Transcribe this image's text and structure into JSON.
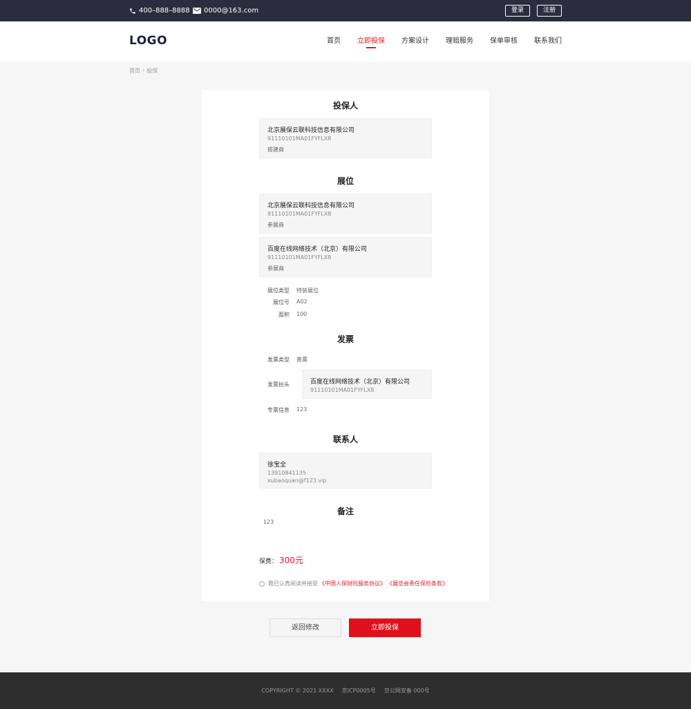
{
  "topbar": {
    "phone": "400–888–8888",
    "email": "0000@163.com",
    "login": "登录",
    "register": "注册"
  },
  "header": {
    "logo": "LOGO",
    "nav": [
      "首页",
      "立即投保",
      "方案设计",
      "理赔服务",
      "保单审核",
      "联系我们"
    ],
    "active": "立即投保"
  },
  "breadcrumb": {
    "home": "首页",
    "sep": "›",
    "current": "投保"
  },
  "policyholder": {
    "title": "投保人",
    "name": "北京展保云联科技信息有限公司",
    "code": "91110101MA01FYFLX8",
    "role": "搭建商"
  },
  "booth": {
    "title": "展位",
    "items": [
      {
        "name": "北京展保云联科技信息有限公司",
        "code": "91110101MA01FYFLX8",
        "role": "参展商"
      },
      {
        "name": "百度在线网络技术（北京）有限公司",
        "code": "91110101MA01FYFLX8",
        "role": "参展商"
      }
    ],
    "type_label": "展位类型",
    "type_value": "特装展位",
    "no_label": "展位号",
    "no_value": "A02",
    "area_label": "面积",
    "area_value": "100"
  },
  "invoice": {
    "title": "发票",
    "type_label": "发票类型",
    "type_value": "普票",
    "header_label": "发票抬头",
    "header_name": "百度在线网络技术（北京）有限公司",
    "header_code": "91110101MA01FYFLX8",
    "special_label": "专票信息",
    "special_value": "123"
  },
  "contact": {
    "title": "联系人",
    "name": "徐宝全",
    "phone": "13910841135",
    "email": "xubaoquan@f123.vip"
  },
  "remark": {
    "title": "备注",
    "value": "123"
  },
  "fee": {
    "label": "保费：",
    "amount": "300元"
  },
  "agreement": {
    "text": "我已认真阅读并接受",
    "link1": "《中国人保财险服务协议》",
    "link2": "《展览会责任保险条款》"
  },
  "actions": {
    "back": "返回修改",
    "submit": "立即投保"
  },
  "footer": {
    "copyright": "COPYRIGHT © 2021 XXXX",
    "icp": "京ICP0005号",
    "police": "京公网安备 000号"
  }
}
